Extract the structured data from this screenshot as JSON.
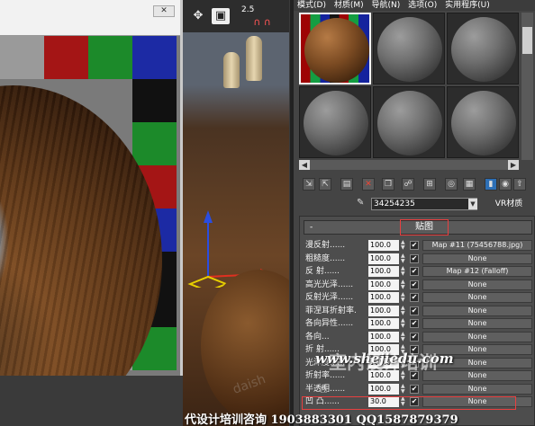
{
  "preview": {
    "close_label": "✕",
    "checker_colors": [
      "#a41515",
      "#1c8a2a",
      "#1c2aa4",
      "#111111",
      "#9a9a9a"
    ]
  },
  "viewport": {
    "zoom_label": "2.5"
  },
  "menubar": {
    "items": [
      "模式(D)",
      "材质(M)",
      "导航(N)",
      "选项(O)",
      "实用程序(U)"
    ]
  },
  "material": {
    "name": "34254235",
    "type": "VR材质"
  },
  "maps": {
    "rollout_title": "贴图",
    "rows": [
      {
        "label": "漫反射......",
        "value": "100.0",
        "checked": "✔",
        "map": "Map #11 (75456788.jpg)"
      },
      {
        "label": "粗糙度......",
        "value": "100.0",
        "checked": "✔",
        "map": "None"
      },
      {
        "label": "反  射......",
        "value": "100.0",
        "checked": "✔",
        "map": "Map #12 (Falloff)"
      },
      {
        "label": "高光光泽......",
        "value": "100.0",
        "checked": "✔",
        "map": "None"
      },
      {
        "label": "反射光泽......",
        "value": "100.0",
        "checked": "✔",
        "map": "None"
      },
      {
        "label": "菲涅耳折射率.",
        "value": "100.0",
        "checked": "✔",
        "map": "None"
      },
      {
        "label": "各向异性......",
        "value": "100.0",
        "checked": "✔",
        "map": "None"
      },
      {
        "label": "各向...",
        "value": "100.0",
        "checked": "✔",
        "map": "None"
      },
      {
        "label": "折  射......",
        "value": "100.0",
        "checked": "✔",
        "map": "None"
      },
      {
        "label": "光泽度......",
        "value": "100.0",
        "checked": "✔",
        "map": "None"
      },
      {
        "label": "折射率......",
        "value": "100.0",
        "checked": "✔",
        "map": "None"
      },
      {
        "label": "半透明......",
        "value": "100.0",
        "checked": "✔",
        "map": "None"
      },
      {
        "label": "凹  凸......",
        "value": "30.0",
        "checked": "✔",
        "map": "None"
      }
    ]
  },
  "overlay": {
    "url": "www.shejiedu.com",
    "brand": "室内设计培训",
    "bottom": "代设计培训咨询 1903883301 QQ1587879379"
  },
  "colors": {
    "accent_red": "#e84040"
  }
}
